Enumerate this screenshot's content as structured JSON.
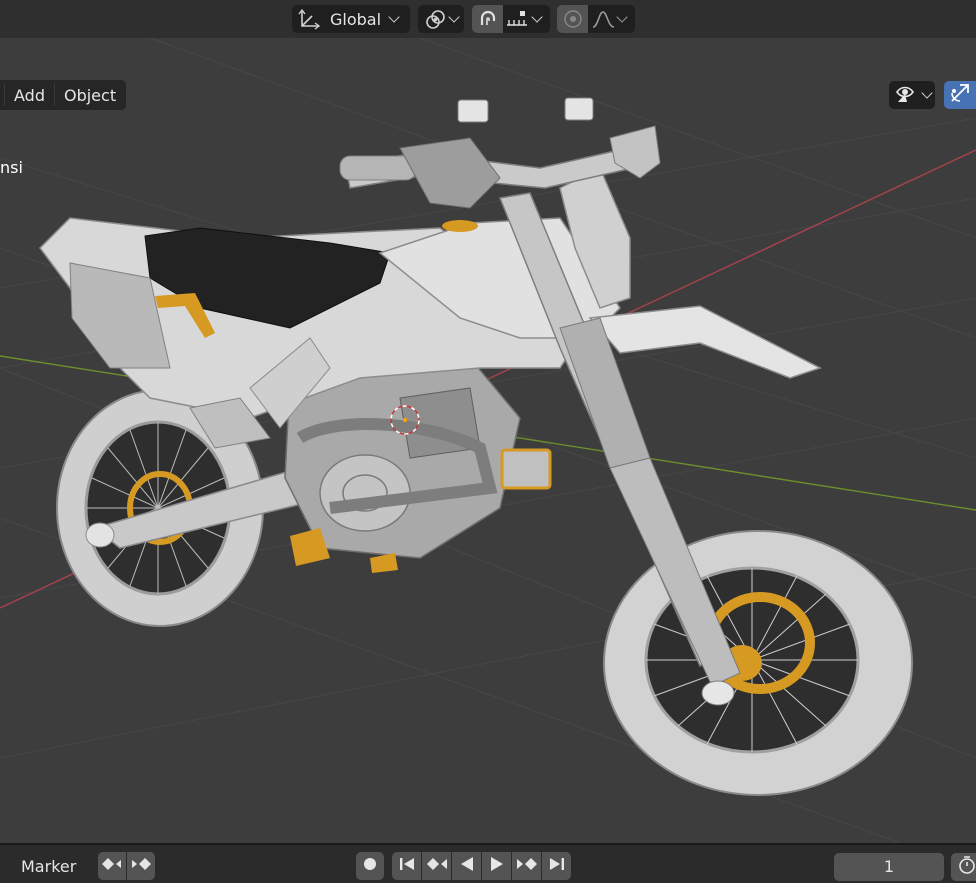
{
  "header": {
    "orientation": {
      "label": "Global",
      "icon": "transform-orientation-icon"
    },
    "pivot": {
      "icon": "pivot-point-icon"
    },
    "snap": {
      "icon": "snap-magnet-icon",
      "target_icon": "snap-increment-icon"
    },
    "proportional": {
      "icon": "proportional-edit-icon",
      "falloff_icon": "falloff-curve-icon"
    }
  },
  "viewport": {
    "menus": [
      "Add",
      "Object"
    ],
    "overlay_text": "nsi",
    "visibility_icon": "selectability-visibility-icon",
    "gizmo_icon": "gizmo-toggle-icon",
    "scene_object": "motorcycle-model",
    "colors": {
      "background": "#3d3d3d",
      "grid": "#474747",
      "x_axis": "#a8434e",
      "y_axis": "#6b8f2b",
      "model_body": "#d6d6d6",
      "model_seat": "#222222",
      "model_accent": "#d69a23",
      "active_button": "#4772b3"
    }
  },
  "timeline": {
    "marker_label": "Marker",
    "keyframe_icons": [
      "prev-keyframe-icon",
      "next-keyframe-icon"
    ],
    "record_icon": "record-icon",
    "playback_icons": [
      "jump-start-icon",
      "jump-prev-keyframe-icon",
      "play-reverse-icon",
      "play-icon",
      "jump-next-keyframe-icon",
      "jump-end-icon"
    ],
    "current_frame": "1",
    "timer_icon": "timer-icon"
  }
}
